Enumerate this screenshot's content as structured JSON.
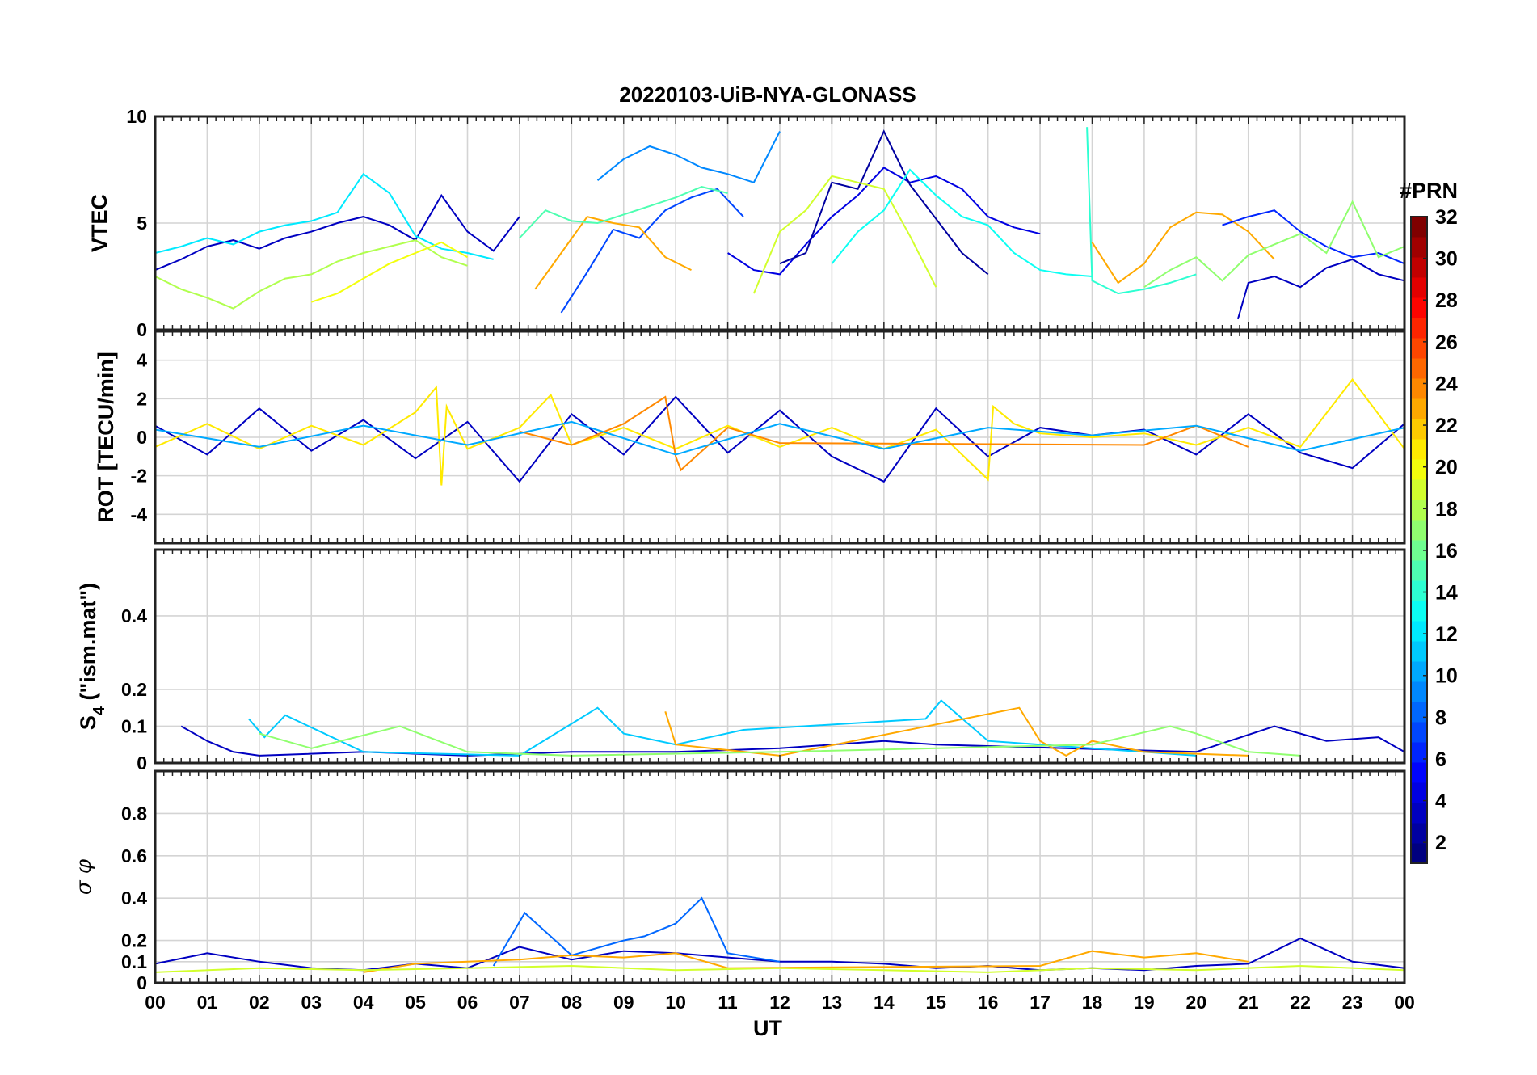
{
  "title": "20220103-UiB-NYA-GLONASS",
  "xlabel": "UT",
  "x_ticks": [
    "00",
    "01",
    "02",
    "03",
    "04",
    "05",
    "06",
    "07",
    "08",
    "09",
    "10",
    "11",
    "12",
    "13",
    "14",
    "15",
    "16",
    "17",
    "18",
    "19",
    "20",
    "21",
    "22",
    "23",
    "00"
  ],
  "colorbar": {
    "title": "#PRN",
    "ticks": [
      "2",
      "4",
      "6",
      "8",
      "10",
      "12",
      "14",
      "16",
      "18",
      "20",
      "22",
      "24",
      "26",
      "28",
      "30",
      "32"
    ],
    "range": [
      1,
      32
    ],
    "colormap": "jet"
  },
  "chart_data": [
    {
      "type": "line",
      "panel": "vtec",
      "ylabel": "VTEC",
      "yticks": [
        "0",
        "5",
        "10"
      ],
      "ylim": [
        0,
        10
      ],
      "xlim": [
        0,
        24
      ],
      "x_unit": "hours UT",
      "grid": true,
      "series": [
        {
          "prn": 3,
          "x": [
            0.0,
            0.5,
            1.0,
            1.5,
            2.0,
            2.5,
            3.0,
            3.5,
            4.0,
            4.5,
            5.0,
            5.5,
            6.0,
            6.5,
            7.0
          ],
          "y": [
            2.8,
            3.3,
            3.9,
            4.2,
            3.8,
            4.3,
            4.6,
            5.0,
            5.3,
            4.9,
            4.2,
            6.3,
            4.6,
            3.7,
            5.3
          ]
        },
        {
          "prn": 12,
          "x": [
            0.0,
            0.5,
            1.0,
            1.5,
            2.0,
            2.5,
            3.0,
            3.5,
            4.0,
            4.5,
            5.0,
            5.5,
            6.0,
            6.5
          ],
          "y": [
            3.6,
            3.9,
            4.3,
            4.0,
            4.6,
            4.9,
            5.1,
            5.5,
            7.3,
            6.4,
            4.4,
            3.8,
            3.6,
            3.3
          ]
        },
        {
          "prn": 18,
          "x": [
            0.0,
            0.5,
            1.0,
            1.5,
            2.0,
            2.5,
            3.0,
            3.5,
            4.0,
            4.5,
            5.0,
            5.5,
            6.0
          ],
          "y": [
            2.5,
            1.9,
            1.5,
            1.0,
            1.8,
            2.4,
            2.6,
            3.2,
            3.6,
            3.9,
            4.2,
            3.4,
            3.0
          ]
        },
        {
          "prn": 20,
          "x": [
            3.0,
            3.5,
            4.0,
            4.5,
            5.0,
            5.5,
            6.0
          ],
          "y": [
            1.3,
            1.7,
            2.4,
            3.1,
            3.6,
            4.1,
            3.4
          ]
        },
        {
          "prn": 9,
          "x": [
            8.5,
            9.0,
            9.5,
            10.0,
            10.5,
            11.0,
            11.5,
            12.0
          ],
          "y": [
            7.0,
            8.0,
            8.6,
            8.2,
            7.6,
            7.3,
            6.9,
            9.3
          ]
        },
        {
          "prn": 7,
          "x": [
            7.8,
            8.3,
            8.8,
            9.3,
            9.8,
            10.3,
            10.8,
            11.3
          ],
          "y": [
            0.8,
            2.7,
            4.7,
            4.3,
            5.6,
            6.2,
            6.6,
            5.3
          ]
        },
        {
          "prn": 23,
          "x": [
            7.3,
            7.8,
            8.3,
            8.8,
            9.3,
            9.8,
            10.3
          ],
          "y": [
            1.9,
            3.6,
            5.3,
            5.0,
            4.8,
            3.4,
            2.8
          ]
        },
        {
          "prn": 15,
          "x": [
            7.0,
            7.5,
            8.0,
            8.5,
            9.0,
            9.5,
            10.0,
            10.5,
            11.0
          ],
          "y": [
            4.3,
            5.6,
            5.1,
            5.0,
            5.4,
            5.8,
            6.2,
            6.7,
            6.4
          ]
        },
        {
          "prn": 4,
          "x": [
            11.0,
            11.5,
            12.0,
            12.5,
            13.0,
            13.5,
            14.0,
            14.5,
            15.0,
            15.5,
            16.0,
            16.5,
            17.0
          ],
          "y": [
            3.6,
            2.8,
            2.6,
            4.0,
            5.3,
            6.3,
            7.6,
            6.9,
            7.2,
            6.6,
            5.3,
            4.8,
            4.5
          ]
        },
        {
          "prn": 2,
          "x": [
            12.0,
            12.5,
            13.0,
            13.5,
            14.0,
            14.5,
            15.0,
            15.5,
            16.0
          ],
          "y": [
            3.1,
            3.6,
            6.9,
            6.6,
            9.3,
            6.8,
            5.2,
            3.6,
            2.6
          ]
        },
        {
          "prn": 19,
          "x": [
            11.5,
            12.0,
            12.5,
            13.0,
            13.5,
            14.0,
            14.5,
            15.0
          ],
          "y": [
            1.7,
            4.6,
            5.6,
            7.2,
            6.9,
            6.6,
            4.4,
            2.0
          ]
        },
        {
          "prn": 13,
          "x": [
            13.0,
            13.5,
            14.0,
            14.5,
            15.0,
            15.5,
            16.0,
            16.5,
            17.0,
            17.5,
            18.0
          ],
          "y": [
            3.1,
            4.6,
            5.6,
            7.5,
            6.3,
            5.3,
            4.9,
            3.6,
            2.8,
            2.6,
            2.5
          ]
        },
        {
          "prn": 14,
          "x": [
            17.9,
            18.0,
            18.5,
            19.0,
            19.5,
            20.0
          ],
          "y": [
            9.5,
            2.3,
            1.7,
            1.9,
            2.2,
            2.6
          ]
        },
        {
          "prn": 23,
          "x": [
            18.0,
            18.5,
            19.0,
            19.5,
            20.0,
            20.5,
            21.0,
            21.5
          ],
          "y": [
            4.1,
            2.2,
            3.1,
            4.8,
            5.5,
            5.4,
            4.6,
            3.3
          ]
        },
        {
          "prn": 6,
          "x": [
            20.5,
            21.0,
            21.5,
            22.0,
            22.5,
            23.0,
            23.5,
            24.0
          ],
          "y": [
            4.9,
            5.3,
            5.6,
            4.6,
            3.9,
            3.4,
            3.6,
            3.1
          ]
        },
        {
          "prn": 3,
          "x": [
            20.8,
            21.0,
            21.5,
            22.0,
            22.5,
            23.0,
            23.5,
            24.0
          ],
          "y": [
            0.5,
            2.2,
            2.5,
            2.0,
            2.9,
            3.3,
            2.6,
            2.3
          ]
        },
        {
          "prn": 17,
          "x": [
            19.0,
            19.5,
            20.0,
            20.5,
            21.0,
            21.5,
            22.0,
            22.5,
            23.0,
            23.5,
            24.0
          ],
          "y": [
            2.0,
            2.8,
            3.4,
            2.3,
            3.5,
            4.0,
            4.5,
            3.6,
            6.0,
            3.4,
            3.9
          ]
        }
      ]
    },
    {
      "type": "line",
      "panel": "rot",
      "ylabel": "ROT [TECU/min]",
      "yticks": [
        "-4",
        "-2",
        "0",
        "2",
        "4"
      ],
      "ylim": [
        -5.5,
        5.5
      ],
      "xlim": [
        0,
        24
      ],
      "grid": true,
      "series": [
        {
          "prn": 3,
          "x": [
            0,
            1,
            2,
            3,
            4,
            5,
            6,
            7,
            8,
            9,
            10,
            11,
            12,
            13,
            14,
            15,
            16,
            17,
            18,
            19,
            20,
            21,
            22,
            23,
            24
          ],
          "y": [
            0.6,
            -0.9,
            1.5,
            -0.7,
            0.9,
            -1.1,
            0.8,
            -2.3,
            1.2,
            -0.9,
            2.1,
            -0.8,
            1.4,
            -1.0,
            -2.3,
            1.5,
            -1.0,
            0.5,
            0.1,
            0.4,
            -0.9,
            1.2,
            -0.8,
            -1.6,
            0.7
          ]
        },
        {
          "prn": 21,
          "x": [
            0,
            1,
            2,
            3,
            4,
            5,
            5.4,
            5.5,
            5.6,
            6,
            7,
            7.6,
            8,
            9,
            10,
            11,
            12,
            13,
            14,
            15,
            16,
            16.1,
            16.5,
            17,
            18,
            19,
            20,
            21,
            22,
            23,
            24
          ],
          "y": [
            -0.5,
            0.7,
            -0.6,
            0.6,
            -0.4,
            1.3,
            2.6,
            -2.5,
            1.6,
            -0.6,
            0.5,
            2.2,
            -0.4,
            0.5,
            -0.6,
            0.6,
            -0.5,
            0.5,
            -0.6,
            0.4,
            -2.2,
            1.6,
            0.7,
            0.2,
            0.0,
            0.2,
            -0.4,
            0.5,
            -0.5,
            3.0,
            -0.6
          ]
        },
        {
          "prn": 24,
          "x": [
            7,
            8,
            9,
            9.8,
            10,
            10.1,
            11,
            12,
            19,
            20,
            21
          ],
          "y": [
            0.3,
            -0.4,
            0.7,
            2.1,
            -1.0,
            -1.7,
            0.5,
            -0.3,
            -0.4,
            0.6,
            -0.5
          ]
        },
        {
          "prn": 10,
          "x": [
            0,
            2,
            4,
            6,
            8,
            10,
            12,
            14,
            16,
            18,
            20,
            22,
            24
          ],
          "y": [
            0.4,
            -0.5,
            0.6,
            -0.4,
            0.8,
            -0.9,
            0.7,
            -0.6,
            0.5,
            0.1,
            0.6,
            -0.7,
            0.5
          ]
        }
      ]
    },
    {
      "type": "line",
      "panel": "s4",
      "ylabel_main": "S",
      "ylabel_sub": "4",
      "ylabel_rest": " (\"ism.mat\")",
      "yticks": [
        "0",
        "0.1",
        "0.2",
        "0.4"
      ],
      "ylim": [
        0,
        0.58
      ],
      "xlim": [
        0,
        24
      ],
      "grid": true,
      "series": [
        {
          "prn": 3,
          "x": [
            0.5,
            1.0,
            1.5,
            2.0,
            4.0,
            6.0,
            8.0,
            10.0,
            12.0,
            14.0,
            15.0,
            20.0,
            21.5,
            22.5,
            23.5,
            24.0
          ],
          "y": [
            0.1,
            0.06,
            0.03,
            0.02,
            0.03,
            0.02,
            0.03,
            0.03,
            0.04,
            0.06,
            0.05,
            0.03,
            0.1,
            0.06,
            0.07,
            0.03
          ]
        },
        {
          "prn": 11,
          "x": [
            1.8,
            2.1,
            2.5,
            4.0,
            7.0,
            8.5,
            9.0,
            10.0,
            11.3,
            14.8,
            15.1,
            16.0,
            20.0
          ],
          "y": [
            0.12,
            0.07,
            0.13,
            0.03,
            0.02,
            0.15,
            0.08,
            0.05,
            0.09,
            0.12,
            0.17,
            0.06,
            0.02
          ]
        },
        {
          "prn": 23,
          "x": [
            9.8,
            10.0,
            12.0,
            16.6,
            17.0,
            17.5,
            18.0,
            19.0,
            21.0
          ],
          "y": [
            0.14,
            0.05,
            0.02,
            0.15,
            0.06,
            0.02,
            0.06,
            0.03,
            0.02
          ]
        },
        {
          "prn": 17,
          "x": [
            2.0,
            3.0,
            4.7,
            6.0,
            8.0,
            12.0,
            18.0,
            19.5,
            20.0,
            21.0,
            22.0
          ],
          "y": [
            0.08,
            0.04,
            0.1,
            0.03,
            0.02,
            0.03,
            0.05,
            0.1,
            0.08,
            0.03,
            0.02
          ]
        }
      ]
    },
    {
      "type": "line",
      "panel": "sigma_phi",
      "ylabel": "σ φ",
      "yticks": [
        "0",
        "0.1",
        "0.2",
        "0.4",
        "0.6",
        "0.8"
      ],
      "ylim": [
        0,
        1.0
      ],
      "xlim": [
        0,
        24
      ],
      "grid": true,
      "series": [
        {
          "prn": 3,
          "x": [
            0,
            1,
            2,
            3,
            4,
            5,
            6,
            7,
            8,
            9,
            10,
            11,
            12,
            13,
            14,
            15,
            16,
            17,
            18,
            19,
            20,
            21,
            22,
            23,
            24
          ],
          "y": [
            0.09,
            0.14,
            0.1,
            0.07,
            0.06,
            0.09,
            0.07,
            0.17,
            0.11,
            0.15,
            0.14,
            0.12,
            0.1,
            0.1,
            0.09,
            0.07,
            0.08,
            0.06,
            0.07,
            0.06,
            0.08,
            0.09,
            0.21,
            0.1,
            0.07
          ]
        },
        {
          "prn": 8,
          "x": [
            6.5,
            7.1,
            8.0,
            9.0,
            9.4,
            10.0,
            10.5,
            11.0,
            12.0
          ],
          "y": [
            0.08,
            0.33,
            0.13,
            0.2,
            0.22,
            0.28,
            0.4,
            0.14,
            0.1
          ]
        },
        {
          "prn": 23,
          "x": [
            4,
            5,
            6,
            7,
            8,
            9,
            10,
            11,
            17,
            18,
            19,
            20,
            21
          ],
          "y": [
            0.05,
            0.09,
            0.1,
            0.11,
            0.13,
            0.12,
            0.14,
            0.07,
            0.08,
            0.15,
            0.12,
            0.14,
            0.1
          ]
        },
        {
          "prn": 19,
          "x": [
            0,
            2,
            4,
            6,
            8,
            10,
            12,
            14,
            16,
            18,
            20,
            22,
            24
          ],
          "y": [
            0.05,
            0.07,
            0.06,
            0.07,
            0.08,
            0.06,
            0.07,
            0.06,
            0.05,
            0.07,
            0.06,
            0.08,
            0.06
          ]
        }
      ]
    }
  ]
}
